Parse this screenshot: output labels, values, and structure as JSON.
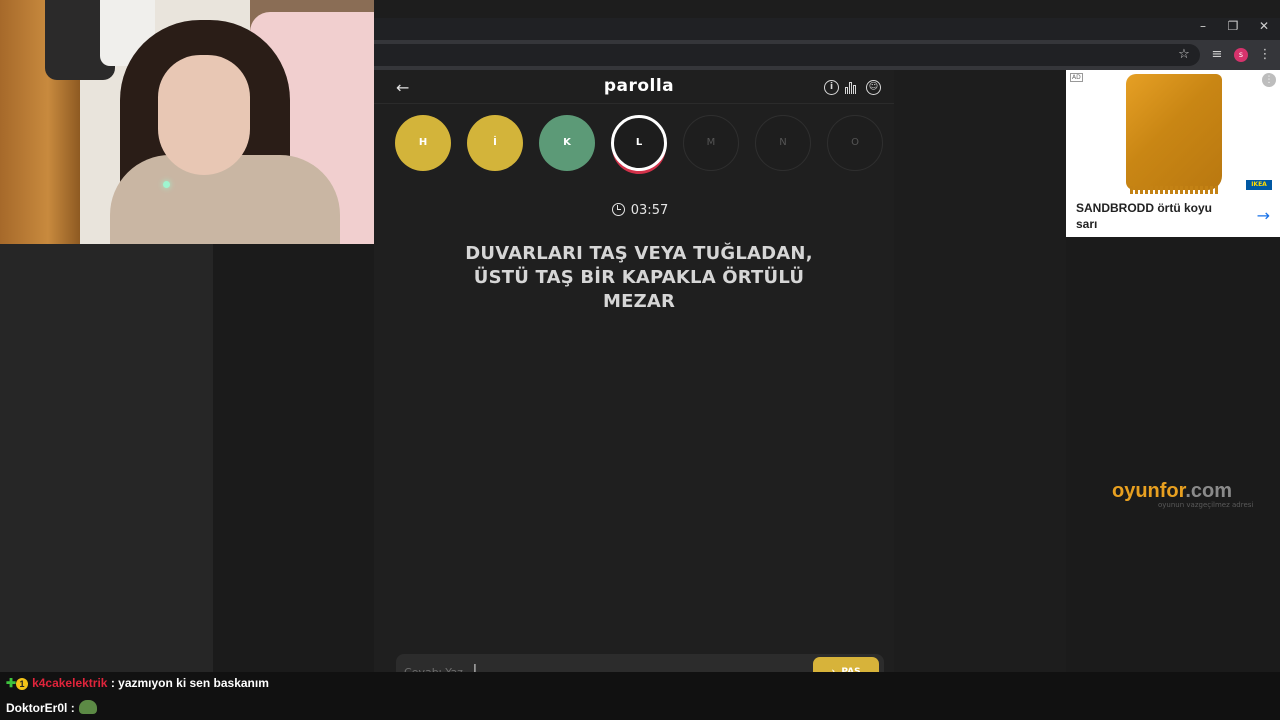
{
  "browser": {
    "window_controls": [
      "–",
      "❐",
      "✕"
    ],
    "toolbar_icons": [
      "star-icon",
      "media-icon",
      "menu-icon"
    ],
    "profile_initial": "s"
  },
  "game": {
    "logo": "parolla",
    "back_symbol": "←",
    "letters": [
      {
        "char": "H",
        "state": "correct-yellow"
      },
      {
        "char": "İ",
        "state": "correct-yellow"
      },
      {
        "char": "K",
        "state": "correct-green"
      },
      {
        "char": "L",
        "state": "active"
      },
      {
        "char": "M",
        "state": "pending"
      },
      {
        "char": "N",
        "state": "pending"
      },
      {
        "char": "O",
        "state": "pending"
      }
    ],
    "timer": "03:57",
    "question": "DUVARLARI TAŞ VEYA TUĞLADAN, ÜSTÜ TAŞ BİR KAPAKLA ÖRTÜLÜ MEZAR",
    "answer_placeholder": "Cevabı Yaz",
    "pass_label": "PAS",
    "colors": {
      "yellow": "#d3b43a",
      "green": "#5c9a77",
      "active_ring": "#d2324a"
    }
  },
  "ad": {
    "badge": "AD",
    "brand": "IKEA",
    "title": "SANDBRODD örtü koyu sarı"
  },
  "watermark": {
    "brand_main": "oyunfor",
    "brand_tld": ".com",
    "tagline": "oyunun vazgeçilmez adresi"
  },
  "chat": {
    "line1": {
      "user": "k4cakelektrik",
      "message": ": yazmıyon ki sen baskanım"
    },
    "line2": {
      "user": "DoktorEr0l",
      "message": ":"
    }
  }
}
